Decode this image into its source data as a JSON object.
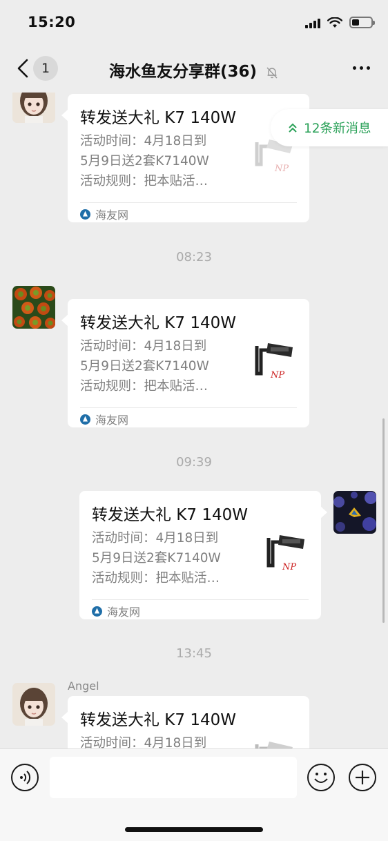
{
  "status_bar": {
    "time": "15:20"
  },
  "nav": {
    "unread_count": "1",
    "title": "海水鱼友分享群(36)",
    "muted_icon": "bell-slash-icon",
    "more_icon": "more-dots-icon"
  },
  "new_messages_label": "12条新消息",
  "card": {
    "title": "转发送大礼 K7 140W",
    "desc_line1": "活动时间：4月18日到",
    "desc_line2": "5月9日送2套K7140W",
    "desc_line3": "活动规则：把本贴活…",
    "source": "海友网"
  },
  "time_separators": [
    "08:23",
    "09:39",
    "13:45"
  ],
  "last_sender_name": "Angel",
  "input_bar": {
    "voice_icon": "voice-icon",
    "emoji_icon": "emoji-icon",
    "plus_icon": "plus-icon",
    "placeholder": ""
  },
  "colors": {
    "accent_green": "#2aa158",
    "background": "#ededed"
  }
}
